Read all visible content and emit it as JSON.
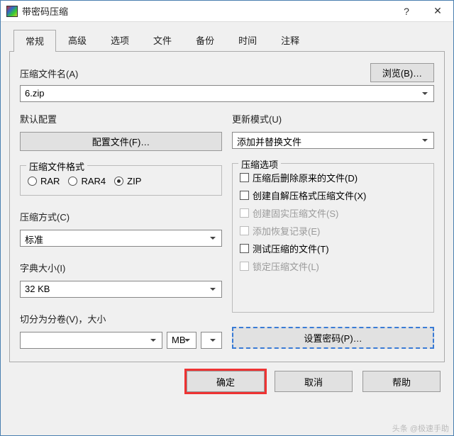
{
  "window": {
    "title": "带密码压缩",
    "help_glyph": "?",
    "close_glyph": "✕"
  },
  "tabs": [
    "常规",
    "高级",
    "选项",
    "文件",
    "备份",
    "时间",
    "注释"
  ],
  "general": {
    "archive_name_label": "压缩文件名(A)",
    "browse_label": "浏览(B)…",
    "archive_name_value": "6.zip",
    "default_profile_label": "默认配置",
    "profiles_button": "配置文件(F)…",
    "update_mode_label": "更新模式(U)",
    "update_mode_value": "添加并替换文件",
    "format_label": "压缩文件格式",
    "format_rar": "RAR",
    "format_rar4": "RAR4",
    "format_zip": "ZIP",
    "method_label": "压缩方式(C)",
    "method_value": "标准",
    "dict_label": "字典大小(I)",
    "dict_value": "32 KB",
    "split_label": "切分为分卷(V)，大小",
    "split_value": "",
    "split_unit": "MB",
    "options_label": "压缩选项",
    "opt_delete": "压缩后删除原来的文件(D)",
    "opt_sfx": "创建自解压格式压缩文件(X)",
    "opt_solid": "创建固实压缩文件(S)",
    "opt_recovery": "添加恢复记录(E)",
    "opt_test": "测试压缩的文件(T)",
    "opt_lock": "锁定压缩文件(L)",
    "password_button": "设置密码(P)…"
  },
  "buttons": {
    "ok": "确定",
    "cancel": "取消",
    "help": "帮助"
  },
  "watermark": "头条 @极速手助"
}
